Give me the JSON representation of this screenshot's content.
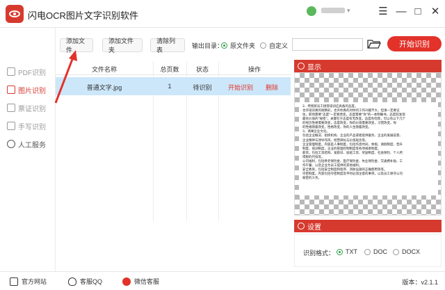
{
  "app": {
    "title": "闪电OCR图片文字识别软件",
    "user_caret": "▾"
  },
  "window": {
    "menu_icon": "☰",
    "minimize_icon": "—",
    "maximize_icon": "□",
    "close_icon": "✕"
  },
  "sidebar": {
    "items": [
      {
        "label": "PDF识别"
      },
      {
        "label": "图片识别"
      },
      {
        "label": "票证识别"
      },
      {
        "label": "手写识别"
      },
      {
        "label": "人工服务"
      }
    ]
  },
  "toolbar": {
    "add_file": "添加文件",
    "add_folder": "添加文件夹",
    "clear_list": "清除列表",
    "output_label": "输出目录：",
    "opt_source": "原文件夹",
    "opt_custom": "自定义",
    "path_value": "",
    "start": "开始识别"
  },
  "table": {
    "headers": [
      "文件名称",
      "总页数",
      "状态",
      "操作"
    ],
    "rows": [
      {
        "name": "普通文字.jpg",
        "pages": "1",
        "status": "待识别",
        "action_start": "开始识别",
        "action_delete": "删除"
      }
    ]
  },
  "preview": {
    "title": "显示",
    "doc_lines": [
      "2、传授新员工接受培训应具备的态度。",
      "也许培训真的很精彩，也许你真的对你的工作兴趣不大，但请一定要记",
      "住，职场需要\"态度\"一定要改变，态度需要\"你\"的一本明确书，态度较发现",
      "最有价值的\"秘密\"，关键在于态度有无改变。态度有何改，可以有以下几个",
      "的经历性格需要改变，态度改变，你的价值需要改变，习惯改变，你",
      "的性格随着改变，性格改变，你的人生随着改变。",
      "3、请阐企业文化。",
      "包括企业概况、组织机构、企业的产品或者提供服务、企业的发展前景、",
      "企业精神与领导作风、经营目标与价值观念等。",
      "企业管理制度。内容是人事制度，包括作息时间、休假、请假制度、晋升",
      "制度、培训制度，企业的管理控制制度等各项规章制度。",
      "薪资，包括工资结构、发薪日、加班工资、奖励制度、社会保险、个人所",
      "得税的代扣等。",
      "公司福利，包括养老保险金、医疗保险金、失业保险金、交通费补贴、工",
      "作午餐、以及企业为员工提供的其他福利。",
      "安全教育，包括安全制度和程序、消防设施的正确使用等等。",
      "守密制度。内容包括守密制度及平时必须注意的事项，以及员工保守公司",
      "秘密的义务。"
    ]
  },
  "settings": {
    "title": "设置",
    "format_label": "识别格式：",
    "formats": [
      "TXT",
      "DOC",
      "DOCX"
    ]
  },
  "footer": {
    "website": "官方网站",
    "qq": "客服QQ",
    "wechat": "微信客服",
    "version": "版本：v2.1.1"
  },
  "colors": {
    "accent": "#d63a2f",
    "selected_row": "#cce7fa",
    "radio_checked": "#2c9c44"
  }
}
